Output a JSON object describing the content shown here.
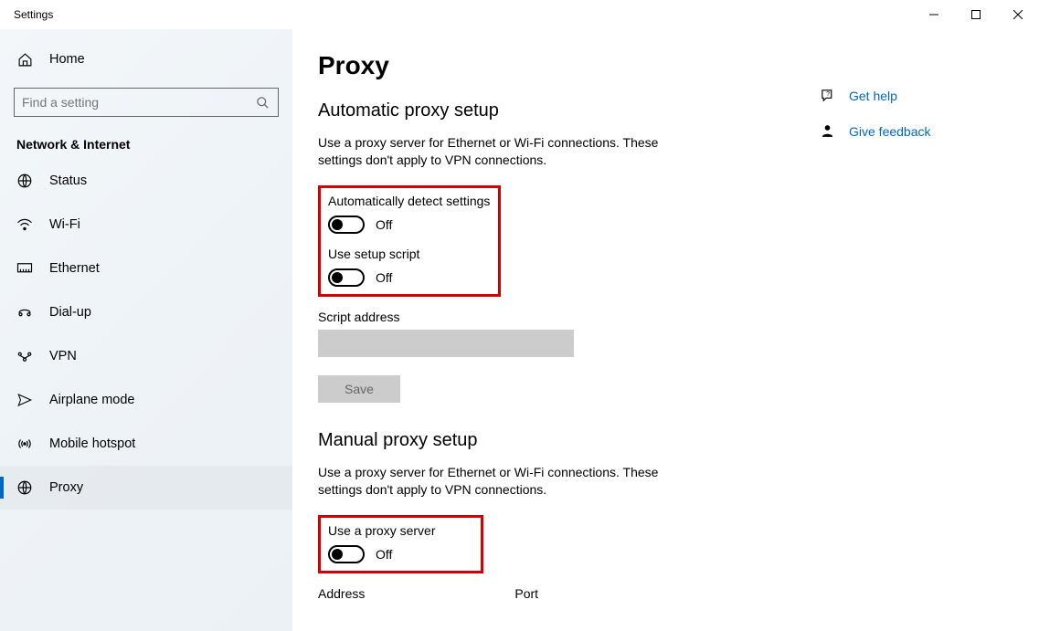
{
  "window": {
    "title": "Settings"
  },
  "sidebar": {
    "home": "Home",
    "search_placeholder": "Find a setting",
    "section": "Network & Internet",
    "items": [
      {
        "label": "Status"
      },
      {
        "label": "Wi-Fi"
      },
      {
        "label": "Ethernet"
      },
      {
        "label": "Dial-up"
      },
      {
        "label": "VPN"
      },
      {
        "label": "Airplane mode"
      },
      {
        "label": "Mobile hotspot"
      },
      {
        "label": "Proxy"
      }
    ]
  },
  "page": {
    "title": "Proxy",
    "auto": {
      "title": "Automatic proxy setup",
      "desc": "Use a proxy server for Ethernet or Wi-Fi connections. These settings don't apply to VPN connections.",
      "detect_label": "Automatically detect settings",
      "detect_state": "Off",
      "script_label": "Use setup script",
      "script_state": "Off",
      "script_address_label": "Script address",
      "script_address_value": "",
      "save_label": "Save"
    },
    "manual": {
      "title": "Manual proxy setup",
      "desc": "Use a proxy server for Ethernet or Wi-Fi connections. These settings don't apply to VPN connections.",
      "use_label": "Use a proxy server",
      "use_state": "Off",
      "address_label": "Address",
      "port_label": "Port"
    }
  },
  "side": {
    "help": "Get help",
    "feedback": "Give feedback"
  }
}
